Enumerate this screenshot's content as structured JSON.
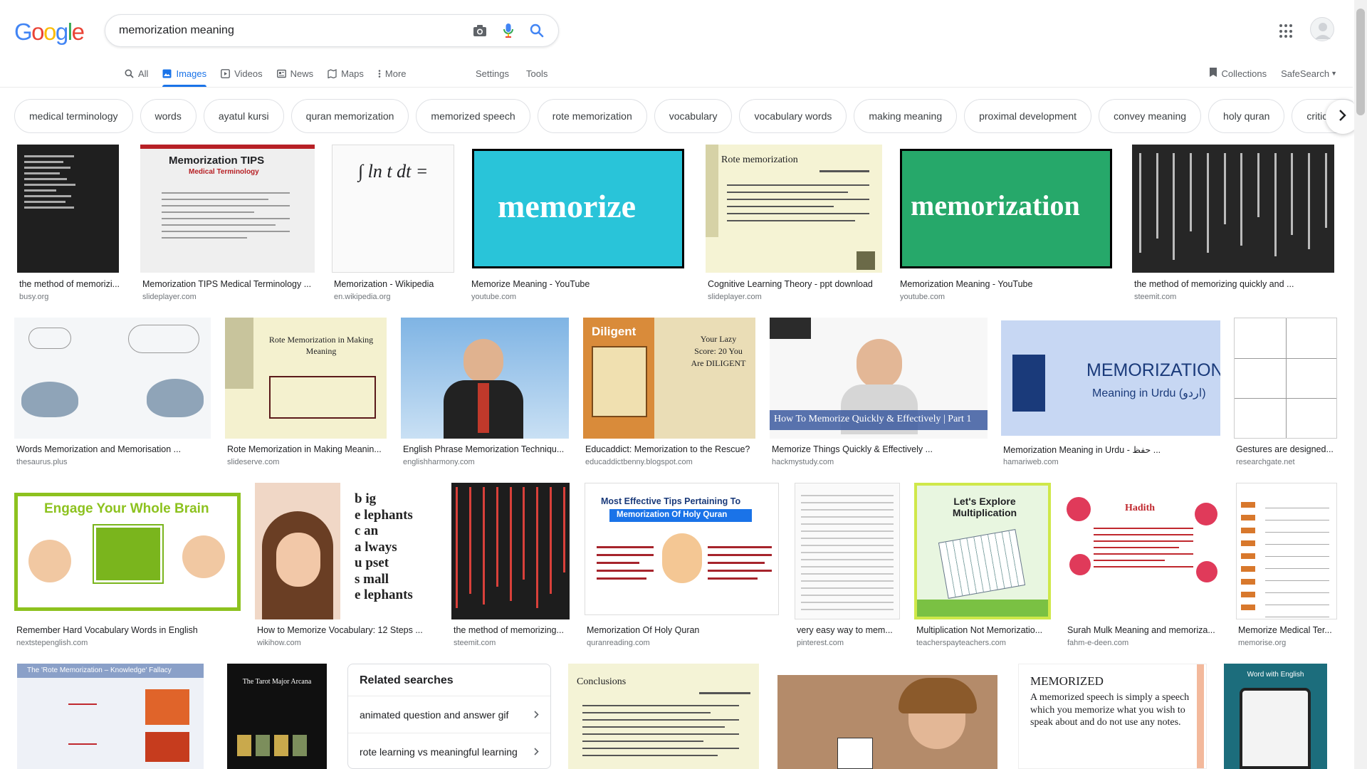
{
  "logo": {
    "letters": [
      "G",
      "o",
      "o",
      "g",
      "l",
      "e"
    ],
    "colors": [
      "#4285f4",
      "#ea4335",
      "#fbbc05",
      "#4285f4",
      "#34a853",
      "#ea4335"
    ]
  },
  "search": {
    "value": "memorization meaning",
    "placeholder": ""
  },
  "tabs": [
    {
      "label": "All",
      "icon": "search-icon",
      "active": false
    },
    {
      "label": "Images",
      "icon": "image-icon",
      "active": true
    },
    {
      "label": "Videos",
      "icon": "video-icon",
      "active": false
    },
    {
      "label": "News",
      "icon": "news-icon",
      "active": false
    },
    {
      "label": "Maps",
      "icon": "map-icon",
      "active": false
    },
    {
      "label": "More",
      "icon": "more-icon",
      "active": false
    }
  ],
  "tools": {
    "settings": "Settings",
    "tools": "Tools"
  },
  "right_nav": {
    "collections": "Collections",
    "safesearch": "SafeSearch"
  },
  "chips": [
    "medical terminology",
    "words",
    "ayatul kursi",
    "quran memorization",
    "memorized speech",
    "rote memorization",
    "vocabulary",
    "vocabulary words",
    "making meaning",
    "proximal development",
    "convey meaning",
    "holy quran",
    "critical th"
  ],
  "results": [
    {
      "caption": "the method of memorizi...",
      "source": "busy.org"
    },
    {
      "caption": "Memorization TIPS Medical Terminology ...",
      "source": "slideplayer.com"
    },
    {
      "caption": "Memorization - Wikipedia",
      "source": "en.wikipedia.org"
    },
    {
      "caption": "Memorize Meaning - YouTube",
      "source": "youtube.com"
    },
    {
      "caption": "Cognitive Learning Theory - ppt download",
      "source": "slideplayer.com"
    },
    {
      "caption": "Memorization Meaning - YouTube",
      "source": "youtube.com"
    },
    {
      "caption": "the method of memorizing quickly and ...",
      "source": "steemit.com"
    },
    {
      "caption": "Words Memorization and Memorisation ...",
      "source": "thesaurus.plus"
    },
    {
      "caption": "Rote Memorization in Making Meanin...",
      "source": "slideserve.com"
    },
    {
      "caption": "English Phrase Memorization Techniqu...",
      "source": "englishharmony.com"
    },
    {
      "caption": "Educaddict: Memorization to the Rescue?",
      "source": "educaddictbenny.blogspot.com"
    },
    {
      "caption": "Memorize Things Quickly & Effectively ...",
      "source": "hackmystudy.com"
    },
    {
      "caption": "Memorization Meaning in Urdu - حفظ ...",
      "source": "hamariweb.com"
    },
    {
      "caption": "Gestures are designed...",
      "source": "researchgate.net"
    },
    {
      "caption": "Remember Hard Vocabulary Words in English",
      "source": "nextstepenglish.com"
    },
    {
      "caption": "How to Memorize Vocabulary: 12 Steps ...",
      "source": "wikihow.com"
    },
    {
      "caption": "the method of memorizing...",
      "source": "steemit.com"
    },
    {
      "caption": "Memorization Of Holy Quran",
      "source": "quranreading.com"
    },
    {
      "caption": "very easy way to mem...",
      "source": "pinterest.com"
    },
    {
      "caption": "Multiplication Not Memorizatio...",
      "source": "teacherspayteachers.com"
    },
    {
      "caption": "Surah Mulk Meaning and memoriza...",
      "source": "fahm-e-deen.com"
    },
    {
      "caption": "Memorize Medical Ter...",
      "source": "memorise.org"
    }
  ],
  "thumb_text": {
    "memorize": "memorize",
    "memorization": "memorization",
    "tips_title": "Memorization TIPS",
    "tips_sub": "Medical Terminology",
    "integral": "∫ ln t dt =",
    "rote": "Rote memorization",
    "rote_making": "Rote Memorization in Making Meaning",
    "diligent": "Diligent",
    "score": "Your Lazy Score: 20 You Are DILIGENT",
    "hack": "How To Memorize Quickly & Effectively | Part 1",
    "urdu_title": "MEMORIZATION",
    "urdu_sub": "Meaning in Urdu (اردو)",
    "brain": "Engage Your Whole Brain",
    "acrostic": [
      "b ig",
      "e lephants",
      "c an",
      "a lways",
      "u pset",
      "s mall",
      "e lephants"
    ],
    "quran_tips": "Most Effective Tips Pertaining To",
    "quran_tips2": "Memorization Of Holy Quran",
    "multiplication": "Let's Explore Multiplication",
    "hadith": "Hadith",
    "fallacy": "The 'Rote Memorization – Knowledge' Fallacy",
    "tarot": "The Tarot Major Arcana",
    "conclusions": "Conclusions",
    "memorized": "MEMORIZED",
    "memorized_body": "A memorized speech is simply a speech which you memorize what you wish to speak about and do not use any notes.",
    "word_english": "Word with English"
  },
  "related": {
    "title": "Related searches",
    "items": [
      "animated question and answer gif",
      "rote learning vs meaningful learning"
    ]
  },
  "colors": {
    "accent": "#1a73e8",
    "memorize_bg": "#29c4d9",
    "memorization_bg": "#26a86a"
  }
}
